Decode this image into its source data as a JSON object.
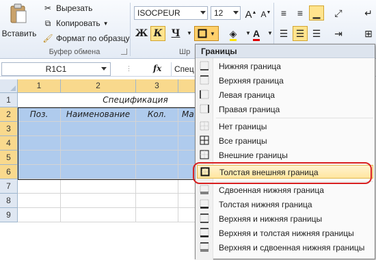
{
  "clipboard": {
    "paste_label": "Вставить",
    "cut_label": "Вырезать",
    "copy_label": "Копировать",
    "format_painter_label": "Формат по образцу",
    "group_label": "Буфер обмена"
  },
  "font_group": {
    "font_name": "ISOCPEUR",
    "font_size": "12",
    "bold": "Ж",
    "italic": "К",
    "underline": "Ч",
    "group_label_partial": "Шр"
  },
  "formula_bar": {
    "name_box": "R1C1",
    "fx": "fx",
    "content": "Спец"
  },
  "grid": {
    "columns": [
      "1",
      "2",
      "3"
    ],
    "rows": [
      "1",
      "2",
      "3",
      "4",
      "5",
      "6",
      "7",
      "8",
      "9"
    ],
    "spec_title": "Спецификация",
    "headers": [
      "Поз.",
      "Наименование",
      "Кол.",
      "Ма"
    ]
  },
  "menu": {
    "title": "Границы",
    "items": [
      {
        "label": "Нижняя граница",
        "icon": "bottom-border-icon"
      },
      {
        "label": "Верхняя граница",
        "icon": "top-border-icon"
      },
      {
        "label": "Левая граница",
        "icon": "left-border-icon"
      },
      {
        "label": "Правая граница",
        "icon": "right-border-icon"
      },
      {
        "label": "Нет границы",
        "icon": "no-border-icon"
      },
      {
        "label": "Все границы",
        "icon": "all-borders-icon"
      },
      {
        "label": "Внешние границы",
        "icon": "outside-borders-icon"
      },
      {
        "label": "Толстая внешняя граница",
        "icon": "thick-box-border-icon"
      },
      {
        "label": "Сдвоенная нижняя граница",
        "icon": "double-bottom-border-icon"
      },
      {
        "label": "Толстая нижняя граница",
        "icon": "thick-bottom-border-icon"
      },
      {
        "label": "Верхняя и нижняя границы",
        "icon": "top-bottom-border-icon"
      },
      {
        "label": "Верхняя и толстая нижняя границы",
        "icon": "top-thick-bottom-border-icon"
      },
      {
        "label": "Верхняя и сдвоенная нижняя границы",
        "icon": "top-double-bottom-border-icon"
      }
    ]
  },
  "colors": {
    "selection": "#afcbed",
    "highlight": "#ffe6a0",
    "annotation": "#d82020"
  }
}
